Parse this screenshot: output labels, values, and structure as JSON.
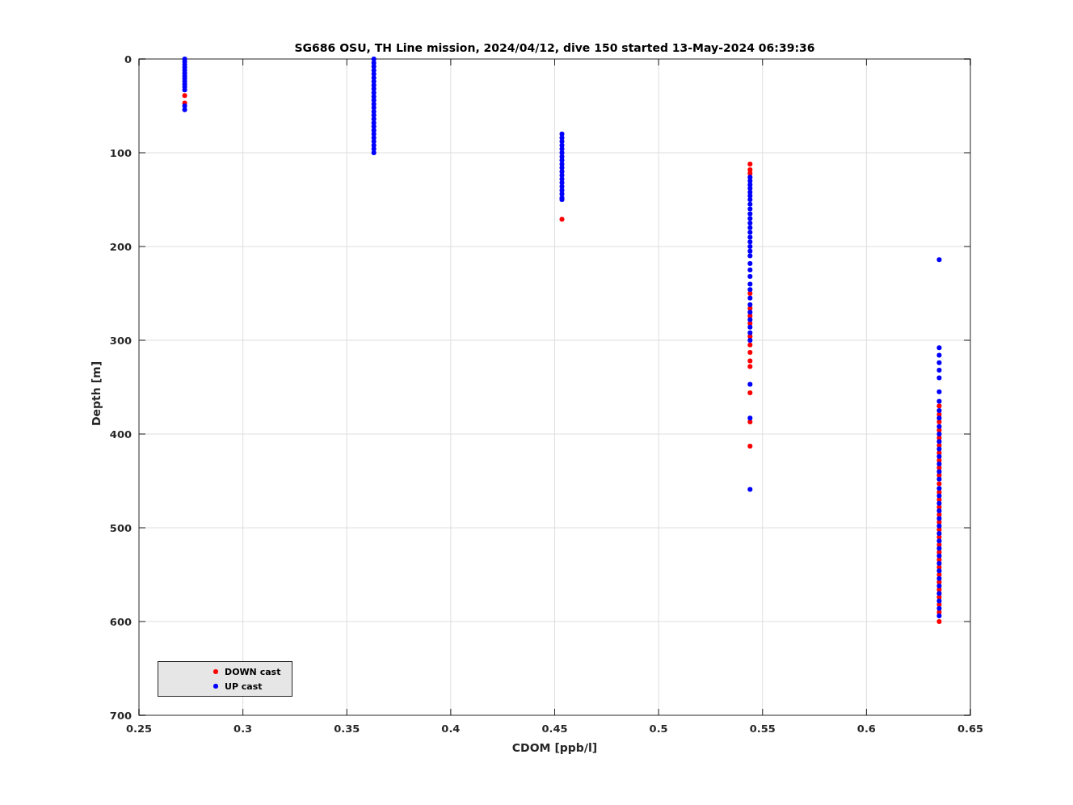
{
  "figure": {
    "chart_data": {
      "type": "scatter",
      "title": "SG686 OSU, TH Line mission, 2024/04/12, dive 150 started 13-May-2024 06:39:36",
      "xlabel": "CDOM [ppb/l]",
      "ylabel": "Depth [m]",
      "xlim": [
        0.25,
        0.65
      ],
      "ylim": [
        700,
        0
      ],
      "xticks": [
        {
          "value": 0.25,
          "label": "0.25"
        },
        {
          "value": 0.3,
          "label": "0.3"
        },
        {
          "value": 0.35,
          "label": "0.35"
        },
        {
          "value": 0.4,
          "label": "0.4"
        },
        {
          "value": 0.45,
          "label": "0.45"
        },
        {
          "value": 0.5,
          "label": "0.5"
        },
        {
          "value": 0.55,
          "label": "0.55"
        },
        {
          "value": 0.6,
          "label": "0.6"
        },
        {
          "value": 0.65,
          "label": "0.65"
        }
      ],
      "yticks": [
        0,
        100,
        200,
        300,
        400,
        500,
        600,
        700
      ],
      "grid": true,
      "series": [
        {
          "name": "DOWN cast",
          "color": "#ff0000",
          "x": [
            0.272,
            0.272,
            0.4535,
            0.544,
            0.544,
            0.544,
            0.544,
            0.544,
            0.544,
            0.544,
            0.544,
            0.544,
            0.544,
            0.544,
            0.544,
            0.544,
            0.544,
            0.544,
            0.635,
            0.635,
            0.635,
            0.635,
            0.635,
            0.635,
            0.635,
            0.635,
            0.635,
            0.635,
            0.635,
            0.635,
            0.635,
            0.635,
            0.635,
            0.635,
            0.635,
            0.635,
            0.635,
            0.635,
            0.635,
            0.635,
            0.635,
            0.635,
            0.635,
            0.635,
            0.635,
            0.635,
            0.635
          ],
          "values": [
            39,
            47,
            171,
            112,
            118,
            122,
            250,
            266,
            274,
            282,
            296,
            305,
            313,
            322,
            328,
            356,
            387,
            413,
            370,
            379,
            387,
            396,
            404,
            412,
            420,
            428,
            436,
            444,
            453,
            462,
            470,
            478,
            486,
            494,
            502,
            510,
            518,
            526,
            534,
            542,
            550,
            558,
            566,
            574,
            582,
            590,
            600
          ]
        },
        {
          "name": "UP cast",
          "color": "#0000ff",
          "x": [
            0.272,
            0.272,
            0.272,
            0.272,
            0.272,
            0.272,
            0.272,
            0.272,
            0.272,
            0.272,
            0.272,
            0.272,
            0.272,
            0.272,
            0.363,
            0.363,
            0.363,
            0.363,
            0.363,
            0.363,
            0.363,
            0.363,
            0.363,
            0.363,
            0.363,
            0.363,
            0.363,
            0.363,
            0.363,
            0.363,
            0.363,
            0.363,
            0.363,
            0.363,
            0.363,
            0.363,
            0.363,
            0.363,
            0.363,
            0.363,
            0.4535,
            0.4535,
            0.4535,
            0.4535,
            0.4535,
            0.4535,
            0.4535,
            0.4535,
            0.4535,
            0.4535,
            0.4535,
            0.4535,
            0.4535,
            0.4535,
            0.4535,
            0.4535,
            0.4535,
            0.4535,
            0.4535,
            0.544,
            0.544,
            0.544,
            0.544,
            0.544,
            0.544,
            0.544,
            0.544,
            0.544,
            0.544,
            0.544,
            0.544,
            0.544,
            0.544,
            0.544,
            0.544,
            0.544,
            0.544,
            0.544,
            0.544,
            0.544,
            0.544,
            0.544,
            0.544,
            0.544,
            0.544,
            0.544,
            0.544,
            0.544,
            0.544,
            0.544,
            0.544,
            0.544,
            0.544,
            0.635,
            0.635,
            0.635,
            0.635,
            0.635,
            0.635,
            0.635,
            0.635,
            0.635,
            0.635,
            0.635,
            0.635,
            0.635,
            0.635,
            0.635,
            0.635,
            0.635,
            0.635,
            0.635,
            0.635,
            0.635,
            0.635,
            0.635,
            0.635,
            0.635,
            0.635,
            0.635,
            0.635,
            0.635,
            0.635,
            0.635,
            0.635,
            0.635,
            0.635,
            0.635,
            0.635
          ],
          "values": [
            0,
            3,
            6,
            9,
            12,
            15,
            18,
            21,
            24,
            27,
            30,
            33,
            50,
            54,
            0,
            4,
            8,
            12,
            16,
            20,
            24,
            28,
            32,
            36,
            40,
            44,
            48,
            52,
            56,
            60,
            64,
            68,
            72,
            76,
            80,
            84,
            88,
            92,
            96,
            100,
            80,
            84,
            88,
            92,
            96,
            100,
            104,
            108,
            112,
            116,
            120,
            124,
            128,
            132,
            136,
            140,
            144,
            148,
            150,
            126,
            130,
            134,
            138,
            142,
            146,
            150,
            155,
            160,
            165,
            170,
            175,
            180,
            185,
            190,
            195,
            200,
            205,
            210,
            218,
            225,
            232,
            240,
            246,
            255,
            262,
            270,
            278,
            286,
            292,
            300,
            347,
            383,
            459,
            214,
            308,
            316,
            324,
            332,
            340,
            355,
            365,
            375,
            383,
            392,
            400,
            408,
            416,
            424,
            432,
            440,
            448,
            458,
            466,
            474,
            482,
            490,
            498,
            506,
            514,
            522,
            530,
            538,
            546,
            554,
            562,
            570,
            578,
            586,
            594
          ]
        }
      ]
    }
  }
}
